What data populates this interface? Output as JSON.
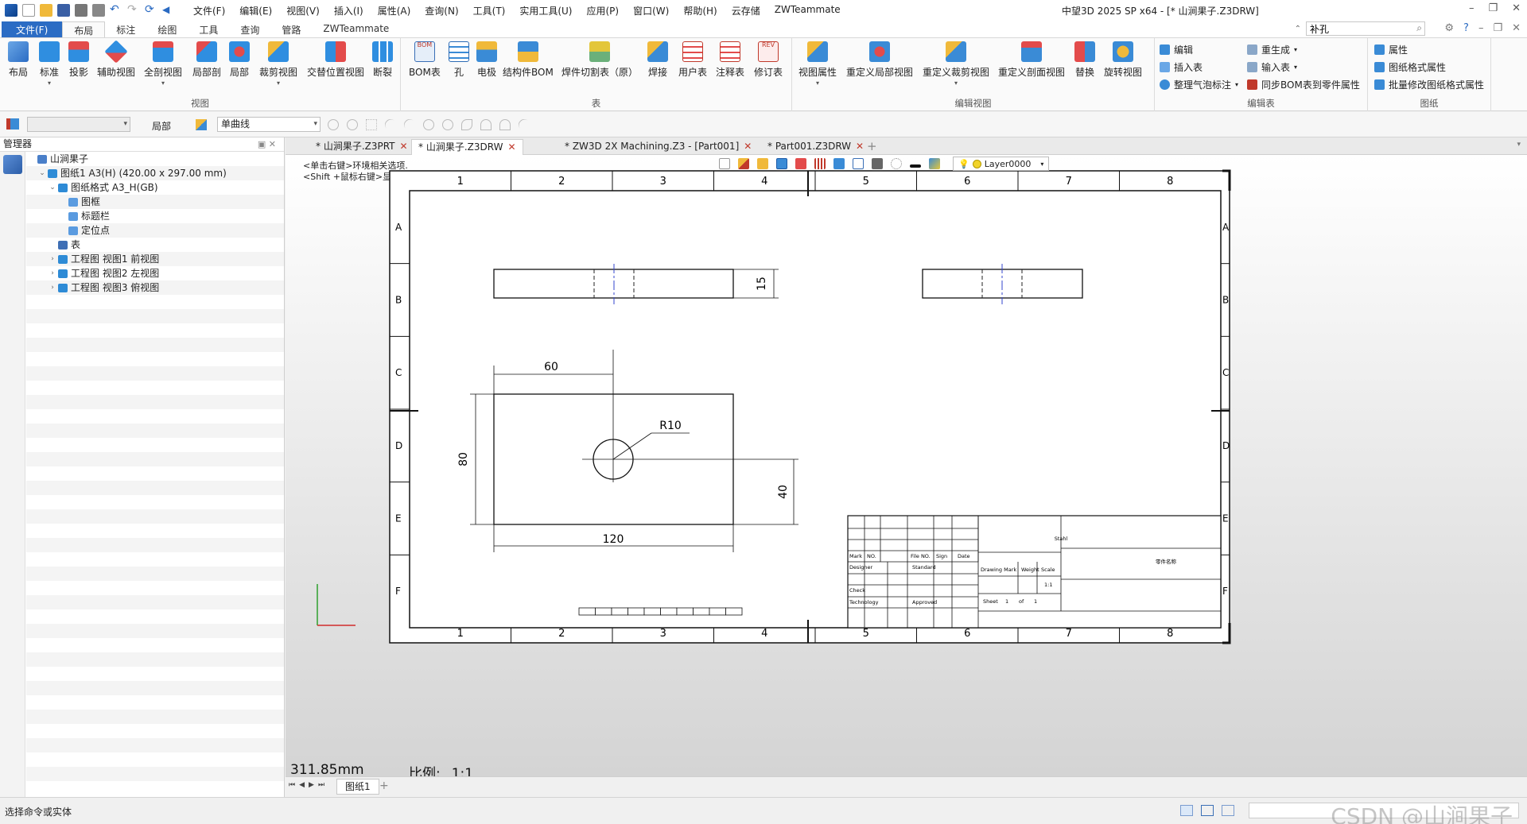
{
  "app": {
    "title": "中望3D 2025 SP x64 - [* 山涧果子.Z3DRW]",
    "menus": [
      "文件(F)",
      "编辑(E)",
      "视图(V)",
      "插入(I)",
      "属性(A)",
      "查询(N)",
      "工具(T)",
      "实用工具(U)",
      "应用(P)",
      "窗口(W)",
      "帮助(H)",
      "云存储",
      "ZWTeammate"
    ],
    "search_value": "补孔"
  },
  "ribbon_tabs": [
    "文件(F)",
    "布局",
    "标注",
    "绘图",
    "工具",
    "查询",
    "管路",
    "ZWTeammate"
  ],
  "ribbon": {
    "view_group": {
      "label": "视图",
      "buttons": [
        "布局",
        "标准",
        "投影",
        "辅助视图",
        "全剖视图",
        "局部剖",
        "局部",
        "裁剪视图",
        "交替位置视图",
        "断裂"
      ]
    },
    "table_group": {
      "label": "表",
      "buttons": [
        "BOM表",
        "孔",
        "电极",
        "结构件BOM",
        "焊件切割表（原）",
        "焊接",
        "用户表",
        "注释表",
        "修订表"
      ]
    },
    "edit_view_group": {
      "label": "编辑视图",
      "buttons": [
        "视图属性",
        "重定义局部视图",
        "重定义裁剪视图",
        "重定义剖面视图",
        "替换",
        "旋转视图"
      ]
    },
    "edit_table_group": {
      "label": "编辑表",
      "items": [
        "编辑",
        "插入表",
        "整理气泡标注",
        "重生成",
        "输入表",
        "同步BOM表到零件属性"
      ]
    },
    "sheet_group": {
      "label": "图纸",
      "items": [
        "属性",
        "图纸格式属性",
        "批量修改图纸格式属性"
      ]
    }
  },
  "toolbar2": {
    "filter_label": "局部",
    "curve_type": "单曲线"
  },
  "manager": {
    "title": "管理器",
    "tree": [
      {
        "label": "山涧果子",
        "indent": 0,
        "expander": "",
        "color": "#4a7fc9"
      },
      {
        "label": "图纸1 A3(H) (420.00 x 297.00 mm)",
        "indent": 1,
        "expander": "⌄",
        "color": "#2e8bd6"
      },
      {
        "label": "图纸格式 A3_H(GB)",
        "indent": 2,
        "expander": "⌄",
        "color": "#2e8bd6"
      },
      {
        "label": "图框",
        "indent": 3,
        "expander": "",
        "color": "#5a9be0"
      },
      {
        "label": "标题栏",
        "indent": 3,
        "expander": "",
        "color": "#5a9be0"
      },
      {
        "label": "定位点",
        "indent": 3,
        "expander": "",
        "color": "#5a9be0"
      },
      {
        "label": "表",
        "indent": 2,
        "expander": "",
        "color": "#3f6fb5"
      },
      {
        "label": "工程图 视图1 前视图",
        "indent": 2,
        "expander": "›",
        "color": "#2e8bd6"
      },
      {
        "label": "工程图 视图2 左视图",
        "indent": 2,
        "expander": "›",
        "color": "#2e8bd6"
      },
      {
        "label": "工程图 视图3 俯视图",
        "indent": 2,
        "expander": "›",
        "color": "#2e8bd6"
      }
    ]
  },
  "doc_tabs": [
    "* 山涧果子.Z3PRT",
    "* 山涧果子.Z3DRW",
    "* ZW3D 2X Machining.Z3 - [Part001]",
    "* Part001.Z3DRW"
  ],
  "canvas": {
    "hint1": "<单击右键>环境相关选项.",
    "hint2": "<Shift +鼠标右键>显示选择过滤器.",
    "layer": "Layer0000",
    "coord": "311.85mm",
    "scale_label": "比例:",
    "scale_value": "1:1"
  },
  "drawing": {
    "cols": [
      "1",
      "2",
      "3",
      "4",
      "5",
      "6",
      "7",
      "8"
    ],
    "rows": [
      "A",
      "B",
      "C",
      "D",
      "E",
      "F"
    ],
    "dims": {
      "width": "60",
      "height": "80",
      "radius": "R10",
      "hole_y": "40",
      "total": "120",
      "thickness": "15"
    },
    "title_block": {
      "material": "Stahl",
      "mark": "Mark",
      "no": "NO.",
      "file_no": "File NO.",
      "sign": "Sign",
      "date": "Date",
      "designer": "Designer",
      "standard": "Standard",
      "drawing_mark": "Drawing Mark",
      "weight": "Weight",
      "scale": "Scale",
      "scale_val": "1:1",
      "check": "Check",
      "technology": "Technology",
      "approved": "Approved",
      "sheet": "Sheet",
      "sheet_num": "1",
      "of": "of",
      "total": "1",
      "name": "零件名称"
    }
  },
  "sheet_tab": "图纸1",
  "status": {
    "message": "选择命令或实体",
    "watermark": "CSDN @山涧果子"
  }
}
